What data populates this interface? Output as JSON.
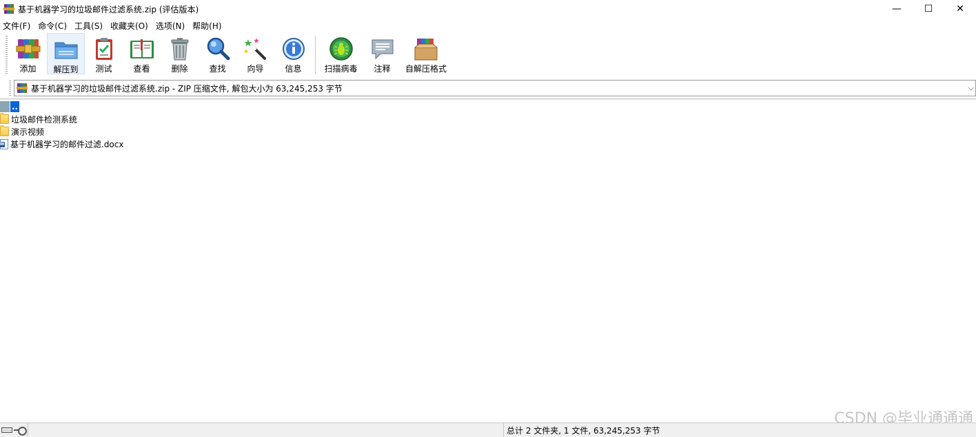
{
  "window": {
    "title": "基于机器学习的垃圾邮件过滤系统.zip (评估版本)",
    "minimize_glyph": "—",
    "maximize_glyph": "☐",
    "close_glyph": "✕"
  },
  "menu": [
    {
      "label": "文件(F)"
    },
    {
      "label": "命令(C)"
    },
    {
      "label": "工具(S)"
    },
    {
      "label": "收藏夹(O)"
    },
    {
      "label": "选项(N)"
    },
    {
      "label": "帮助(H)"
    }
  ],
  "toolbar": [
    {
      "label": "添加",
      "icon": "add-archive-icon"
    },
    {
      "label": "解压到",
      "icon": "extract-to-icon"
    },
    {
      "label": "测试",
      "icon": "test-icon"
    },
    {
      "label": "查看",
      "icon": "view-book-icon"
    },
    {
      "label": "删除",
      "icon": "trash-icon"
    },
    {
      "label": "查找",
      "icon": "magnifier-icon"
    },
    {
      "label": "向导",
      "icon": "wizard-wand-icon"
    },
    {
      "label": "信息",
      "icon": "info-icon"
    },
    {
      "label": "扫描病毒",
      "icon": "virus-scan-icon"
    },
    {
      "label": "注释",
      "icon": "comment-icon"
    },
    {
      "label": "自解压格式",
      "icon": "sfx-box-icon"
    }
  ],
  "address": {
    "text": "基于机器学习的垃圾邮件过滤系统.zip - ZIP 压缩文件, 解包大小为 63,245,253 字节",
    "chevron": "⌵"
  },
  "files": [
    {
      "name": "..",
      "type": "up"
    },
    {
      "name": "垃圾邮件检测系统",
      "type": "folder"
    },
    {
      "name": "演示视频",
      "type": "folder"
    },
    {
      "name": "基于机器学习的邮件过滤.docx",
      "type": "docx"
    }
  ],
  "status": {
    "summary": "总计 2 文件夹, 1 文件, 63,245,253 字节"
  },
  "watermark": "CSDN @毕业通通通",
  "colors": {
    "selection": "#0a64d6",
    "hover": "#eaf2fb"
  }
}
